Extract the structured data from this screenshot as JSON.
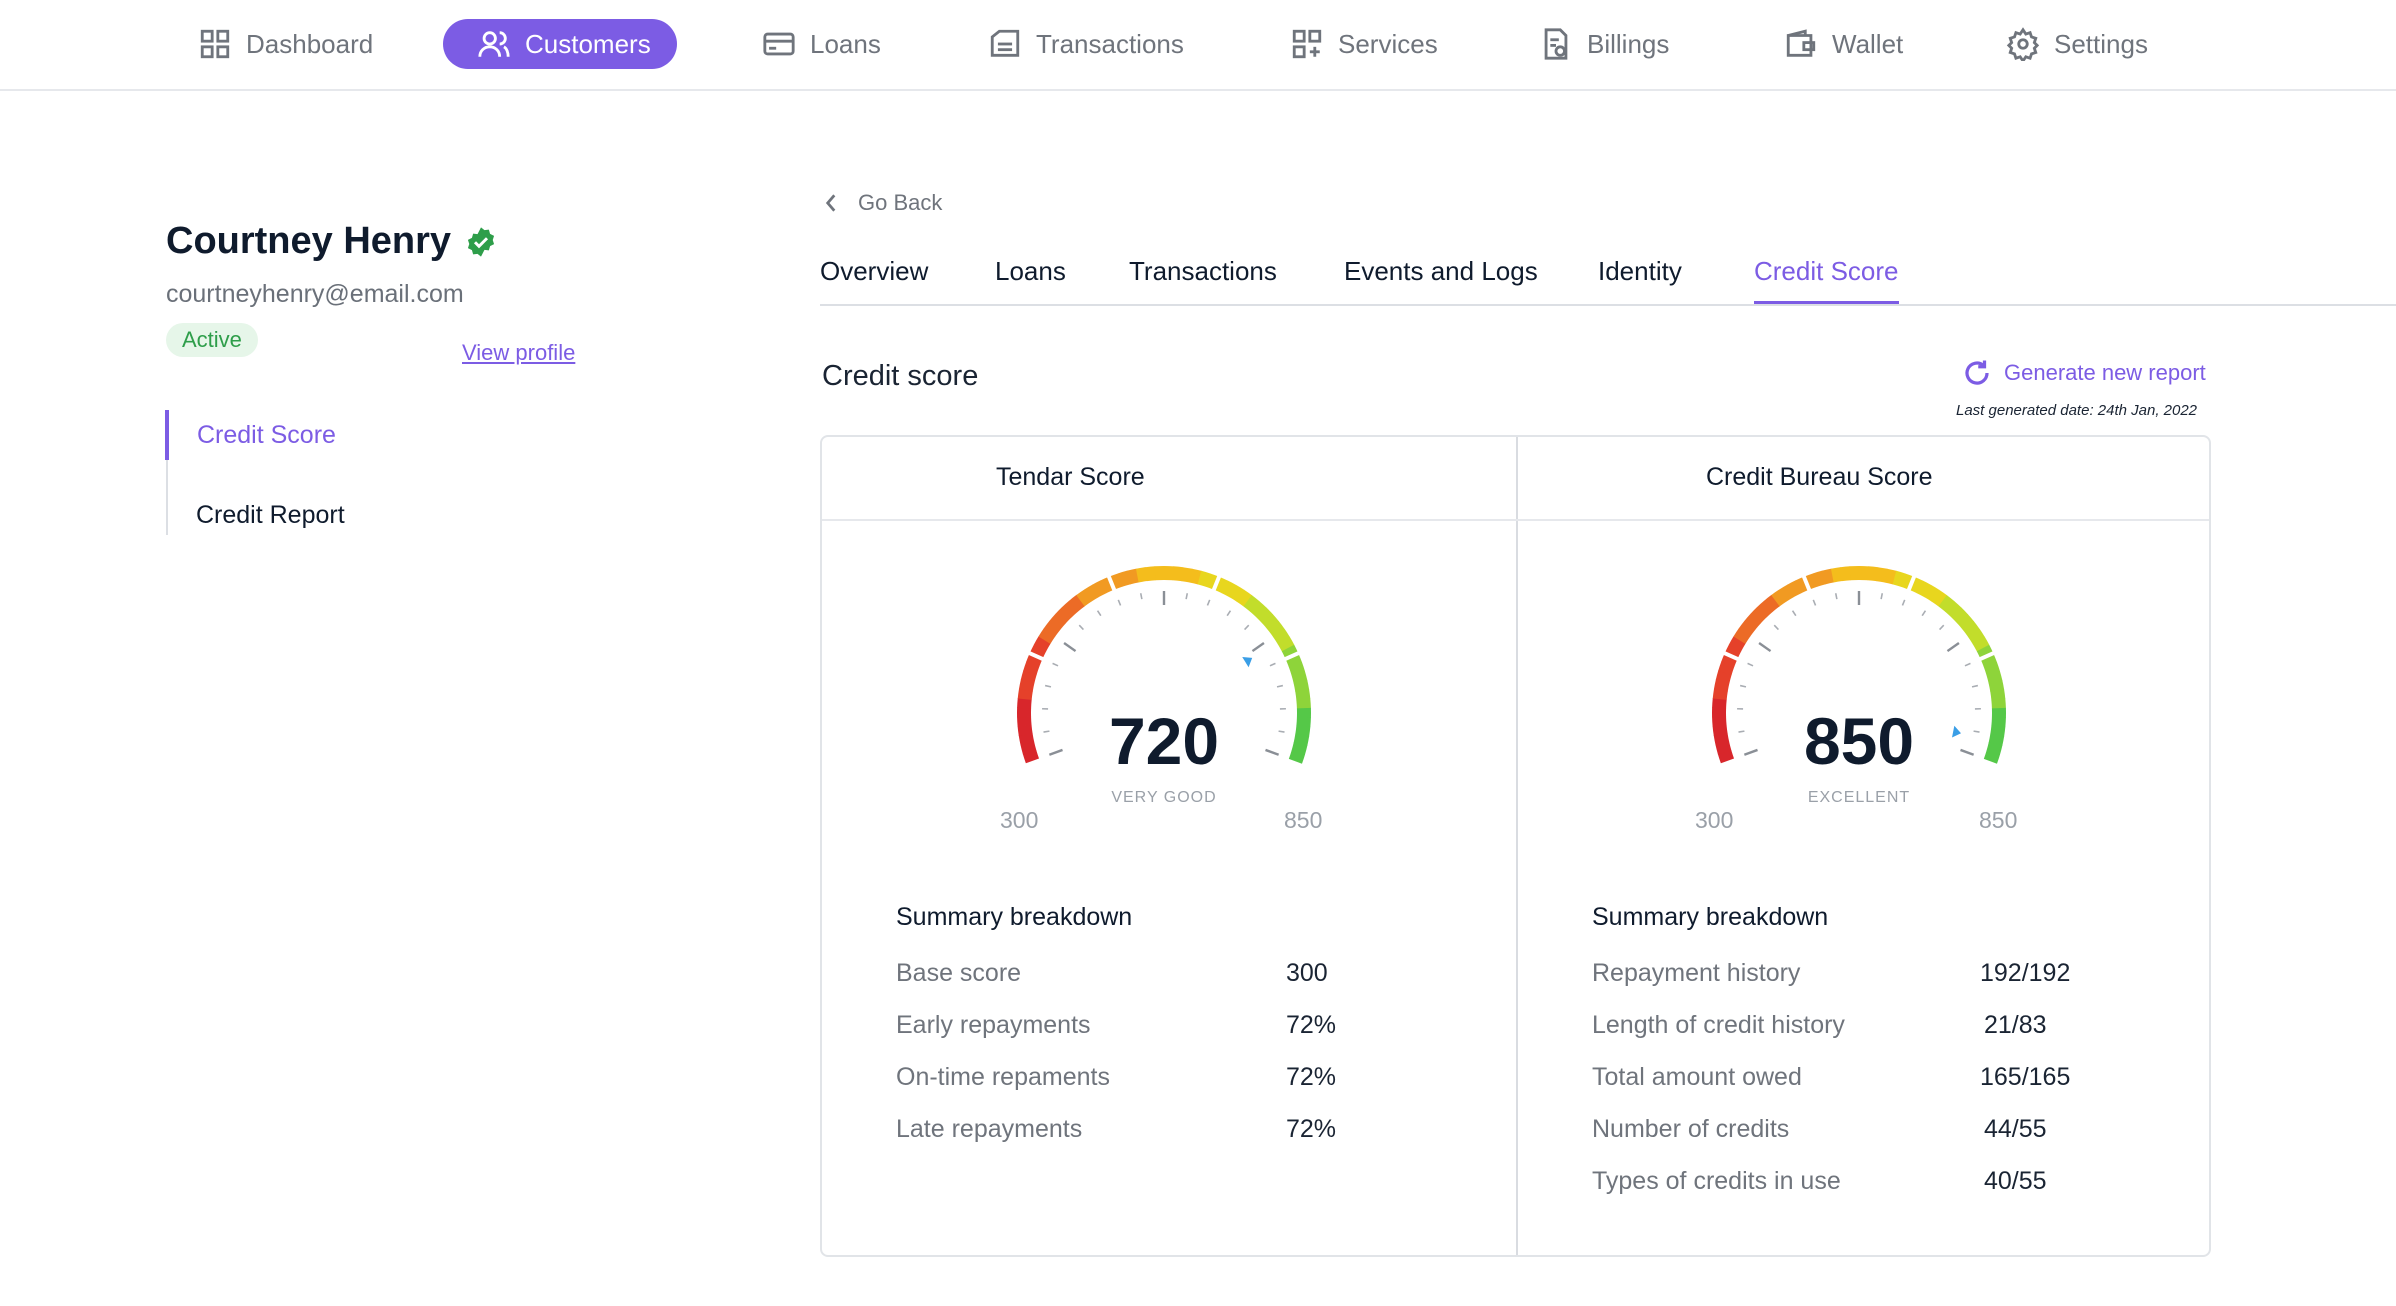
{
  "nav": [
    {
      "label": "Dashboard",
      "icon": "grid-icon"
    },
    {
      "label": "Customers",
      "icon": "users-icon"
    },
    {
      "label": "Loans",
      "icon": "card-icon"
    },
    {
      "label": "Transactions",
      "icon": "receipt-icon"
    },
    {
      "label": "Services",
      "icon": "apps-icon"
    },
    {
      "label": "Billings",
      "icon": "bill-icon"
    },
    {
      "label": "Wallet",
      "icon": "wallet-icon"
    },
    {
      "label": "Settings",
      "icon": "gear-icon"
    }
  ],
  "profile": {
    "name": "Courtney Henry",
    "email": "courtneyhenry@email.com",
    "status": "Active",
    "view_profile": "View profile"
  },
  "side_menu": [
    "Credit Score",
    "Credit Report"
  ],
  "go_back": "Go Back",
  "tabs": [
    "Overview",
    "Loans",
    "Transactions",
    "Events and Logs",
    "Identity",
    "Credit Score"
  ],
  "active_tab": "Credit Score",
  "section": {
    "title": "Credit score",
    "generate_label": "Generate new report",
    "last_generated": "Last generated date: 24th Jan, 2022"
  },
  "tendar": {
    "title": "Tendar Score",
    "score": "720",
    "rating": "VERY GOOD",
    "min": "300",
    "max": "850",
    "score_value": 720,
    "summary_title": "Summary breakdown",
    "rows": [
      {
        "label": "Base score",
        "value": "300"
      },
      {
        "label": "Early repayments",
        "value": "72%"
      },
      {
        "label": "On-time repaments",
        "value": "72%"
      },
      {
        "label": "Late repayments",
        "value": "72%"
      }
    ]
  },
  "bureau": {
    "title": "Credit Bureau Score",
    "score": "850",
    "rating": "EXCELLENT",
    "min": "300",
    "max": "850",
    "score_value": 850,
    "summary_title": "Summary breakdown",
    "rows": [
      {
        "label": "Repayment history",
        "value": "192/192"
      },
      {
        "label": "Length of credit history",
        "value": "21/83"
      },
      {
        "label": "Total amount owed",
        "value": "165/165"
      },
      {
        "label": "Number of credits",
        "value": "44/55"
      },
      {
        "label": "Types of credits in use",
        "value": "40/55"
      }
    ]
  },
  "colors": {
    "accent": "#7c5ce4",
    "active_badge_bg": "#e6f6e9",
    "active_badge_text": "#2e9e4a",
    "verified": "#2e9e4a"
  }
}
